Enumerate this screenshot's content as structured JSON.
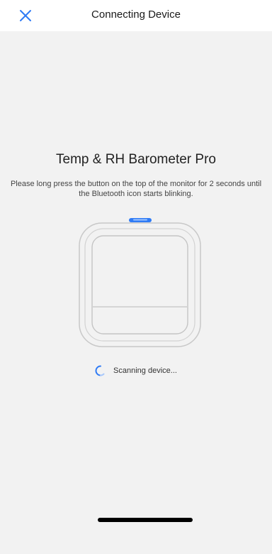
{
  "header": {
    "title": "Connecting Device",
    "close_icon": "close-icon"
  },
  "main": {
    "device_name": "Temp & RH Barometer Pro",
    "instructions": "Please long press the button on the top of the monitor for 2 seconds until the Bluetooth icon starts blinking.",
    "status_text": "Scanning device...",
    "spinner_icon": "loading-spinner-icon"
  },
  "colors": {
    "accent": "#2f7bf5",
    "background": "#f2f2f2",
    "header_background": "#ffffff",
    "device_outline": "#c8c8c8",
    "home_indicator": "#000000"
  }
}
